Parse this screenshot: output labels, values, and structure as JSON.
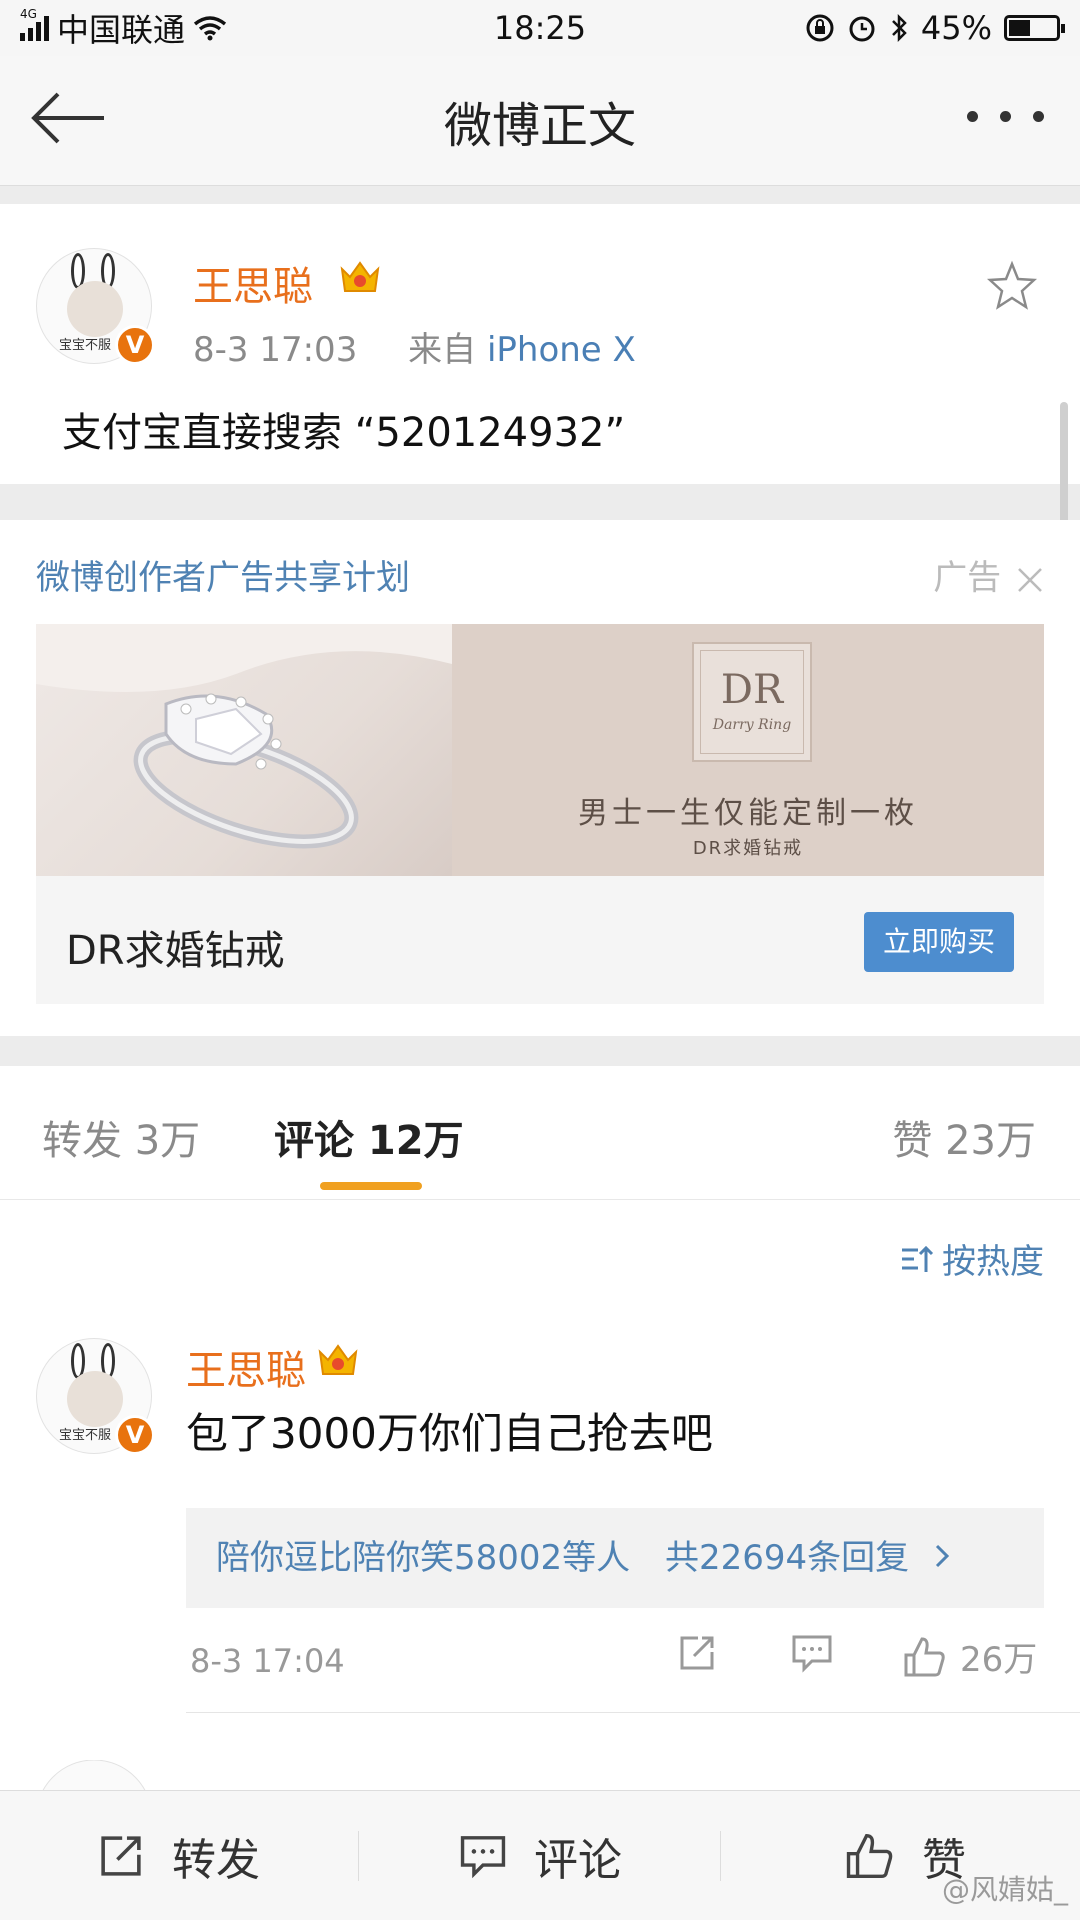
{
  "status_bar": {
    "network": "4G",
    "carrier": "中国联通",
    "time": "18:25",
    "battery": "45%",
    "battery_level": 0.45
  },
  "nav": {
    "title": "微博正文"
  },
  "post": {
    "avatar_caption": "宝宝不服",
    "username": "王思聪",
    "date": "8-3 17:03",
    "source_prefix": "来自",
    "source": "iPhone X",
    "text": "支付宝直接搜索 “520124932”"
  },
  "ad": {
    "header": "微博创作者广告共享计划",
    "label": "广告",
    "logo_mark": "DR",
    "logo_name": "Darry Ring",
    "slogan": "男士一生仅能定制一枚",
    "tagline": "DR求婚钻戒",
    "product": "DR求婚钻戒",
    "buy_label": "立即购买"
  },
  "tabs": {
    "repost": "转发 3万",
    "comment": "评论 12万",
    "like": "赞 23万"
  },
  "comments": {
    "sort_label": "按热度",
    "items": [
      {
        "username": "王思聪",
        "avatar_caption": "宝宝不服",
        "text": "包了3000万你们自己抢去吧",
        "reply_preview": "陪你逗比陪你笑58002等人",
        "reply_count": "共22694条回复",
        "time": "8-3 17:04",
        "likes": "26万"
      }
    ]
  },
  "bottom_bar": {
    "repost": "转发",
    "comment": "评论",
    "like": "赞"
  },
  "watermark": "@风婧姑_",
  "colors": {
    "username": "#e86f1c",
    "link": "#4f82b3",
    "tab_underline": "#f0a020",
    "buy_button": "#4d8dcf"
  }
}
